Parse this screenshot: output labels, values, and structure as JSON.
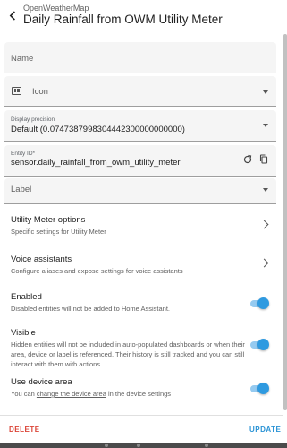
{
  "header": {
    "subtitle": "OpenWeatherMap",
    "title": "Daily Rainfall from OWM Utility Meter"
  },
  "form": {
    "name_placeholder": "Name",
    "icon_placeholder": "Icon",
    "precision_label": "Display precision",
    "precision_value": "Default (0.0747387998304442300000000000)",
    "entity_id_label": "Entity ID*",
    "entity_id_value": "sensor.daily_rainfall_from_owm_utility_meter",
    "label_placeholder": "Label"
  },
  "options": {
    "utility_meter": {
      "title": "Utility Meter options",
      "desc": "Specific settings for Utility Meter"
    },
    "voice": {
      "title": "Voice assistants",
      "desc": "Configure aliases and expose settings for voice assistants"
    }
  },
  "toggles": {
    "enabled": {
      "title": "Enabled",
      "desc": "Disabled entities will not be added to Home Assistant.",
      "on": true
    },
    "visible": {
      "title": "Visible",
      "desc": "Hidden entities will not be included in auto-populated dashboards or when their area, device or label is referenced. Their history is still tracked and you can still interact with them with actions.",
      "on": true
    },
    "device_area": {
      "title": "Use device area",
      "desc_prefix": "You can ",
      "desc_link": "change the device area",
      "desc_suffix": " in the device settings",
      "on": true
    }
  },
  "footer": {
    "delete_label": "DELETE",
    "update_label": "UPDATE"
  },
  "colors": {
    "accent": "#2f9ae0",
    "danger": "#db4437",
    "field_bg": "#f5f5f5"
  },
  "icons": [
    "arrow-left-icon",
    "dashboard-icon",
    "refresh-icon",
    "copy-icon",
    "chevron-right-icon",
    "caret-down-icon"
  ]
}
